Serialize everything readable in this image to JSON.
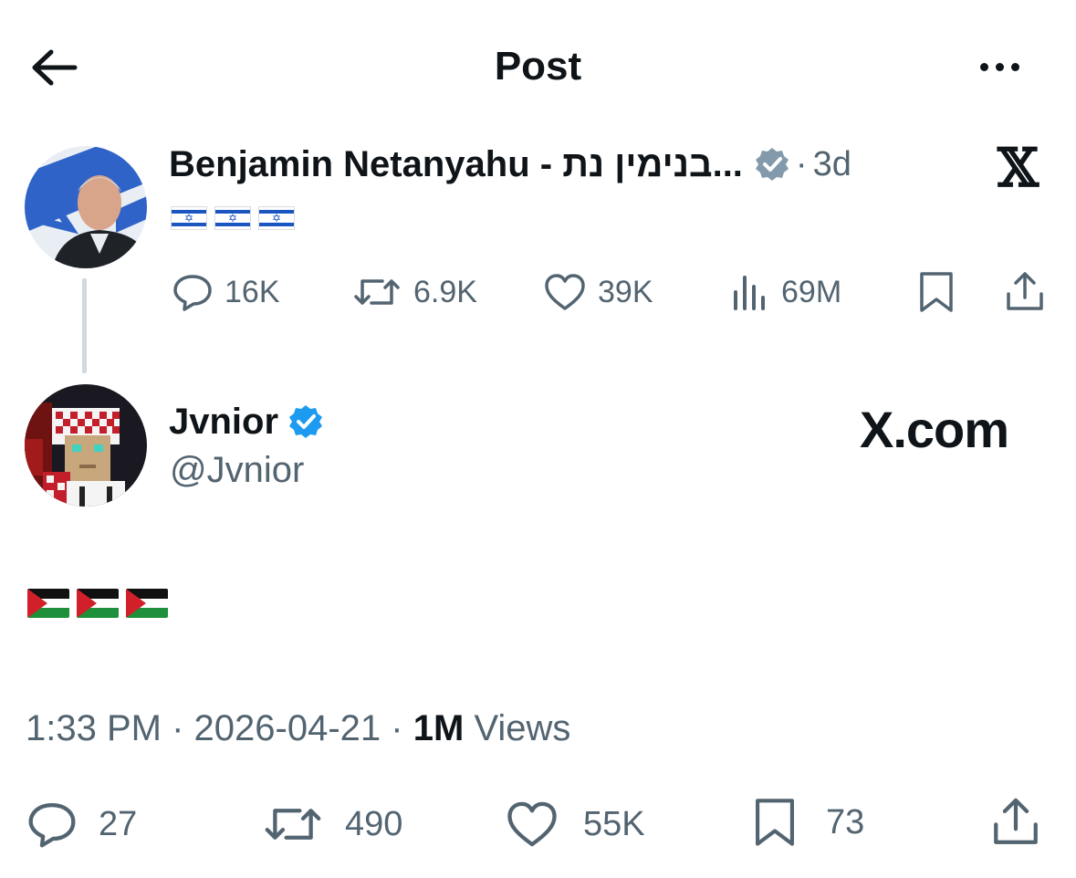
{
  "header": {
    "title": "Post"
  },
  "parent_post": {
    "author_name": "Benjamin Netanyahu - בנימין נת...",
    "separator": "·",
    "time_ago": "3d",
    "content": "🇮🇱🇮🇱🇮🇱",
    "stats": {
      "replies": "16K",
      "reposts": "6.9K",
      "likes": "39K",
      "views": "69M"
    }
  },
  "reply_post": {
    "author_name": "Jvnior",
    "handle": "@Jvnior",
    "watermark": "X.com",
    "content": "🇵🇸🇵🇸🇵🇸",
    "time": "1:33 PM",
    "date": "2026-04-21",
    "views_count": "1M",
    "views_label": "Views",
    "separator": "·",
    "stats": {
      "replies": "27",
      "reposts": "490",
      "likes": "55K",
      "bookmarks": "73"
    }
  },
  "colors": {
    "verified_gray": "#829aab",
    "verified_blue": "#1d9bf0",
    "muted": "#536471",
    "text": "#0f1419"
  },
  "icons": [
    "back-arrow-icon",
    "more-icon",
    "x-logo-icon",
    "reply-icon",
    "repost-icon",
    "like-icon",
    "views-icon",
    "bookmark-icon",
    "share-icon",
    "verified-icon"
  ]
}
